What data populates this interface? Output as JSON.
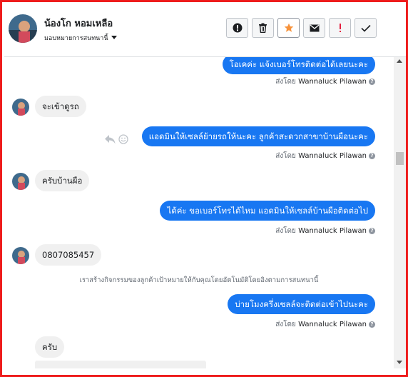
{
  "header": {
    "contact_name": "น้องโก หอมเหลือ",
    "assign_label": "มอบหมายการสนทนานี้",
    "toolbar": [
      "info-icon",
      "trash-icon",
      "star-icon",
      "mail-icon",
      "exclamation-icon",
      "check-icon"
    ]
  },
  "messages": [
    {
      "type": "out",
      "text": "โอเคค่ะ แจ้งเบอร์โทรติดต่อได้เลยนะคะ"
    },
    {
      "type": "sent_by",
      "prefix": "ส่งโดย",
      "name": "Wannaluck Pilawan"
    },
    {
      "type": "in",
      "text": "จะเข้าดูรถ"
    },
    {
      "type": "out",
      "text": "แอดมินให้เซลล์ย้ายรถให้นะคะ ลูกค้าสะดวกสาขาบ้านผือนะคะ"
    },
    {
      "type": "sent_by",
      "prefix": "ส่งโดย",
      "name": "Wannaluck Pilawan"
    },
    {
      "type": "in",
      "text": "ครับบ้านผือ"
    },
    {
      "type": "out",
      "text": "ได้ค่ะ ขอเบอร์โทรได้ไหม แอดมินให้เซลล์บ้านผือติดต่อไป"
    },
    {
      "type": "sent_by",
      "prefix": "ส่งโดย",
      "name": "Wannaluck Pilawan"
    },
    {
      "type": "in",
      "text": "0807085457"
    },
    {
      "type": "system",
      "text": "เราสร้างกิจกรรมของลูกค้าเป้าหมายให้กับคุณโดยอัตโนมัติโดยอิงตามการสนทนานี้"
    },
    {
      "type": "out",
      "text": "บ่ายโมงครึ่งเซลล์จะติดต่อเข้าไปนะคะ"
    },
    {
      "type": "sent_by",
      "prefix": "ส่งโดย",
      "name": "Wannaluck Pilawan"
    },
    {
      "type": "in",
      "text": "ครับ"
    }
  ],
  "colors": {
    "frame": "#ee1c1c",
    "bubble_out": "#1877f2",
    "bubble_in": "#f0f0f0",
    "star": "#f7923a",
    "alert": "#e41e3f"
  }
}
